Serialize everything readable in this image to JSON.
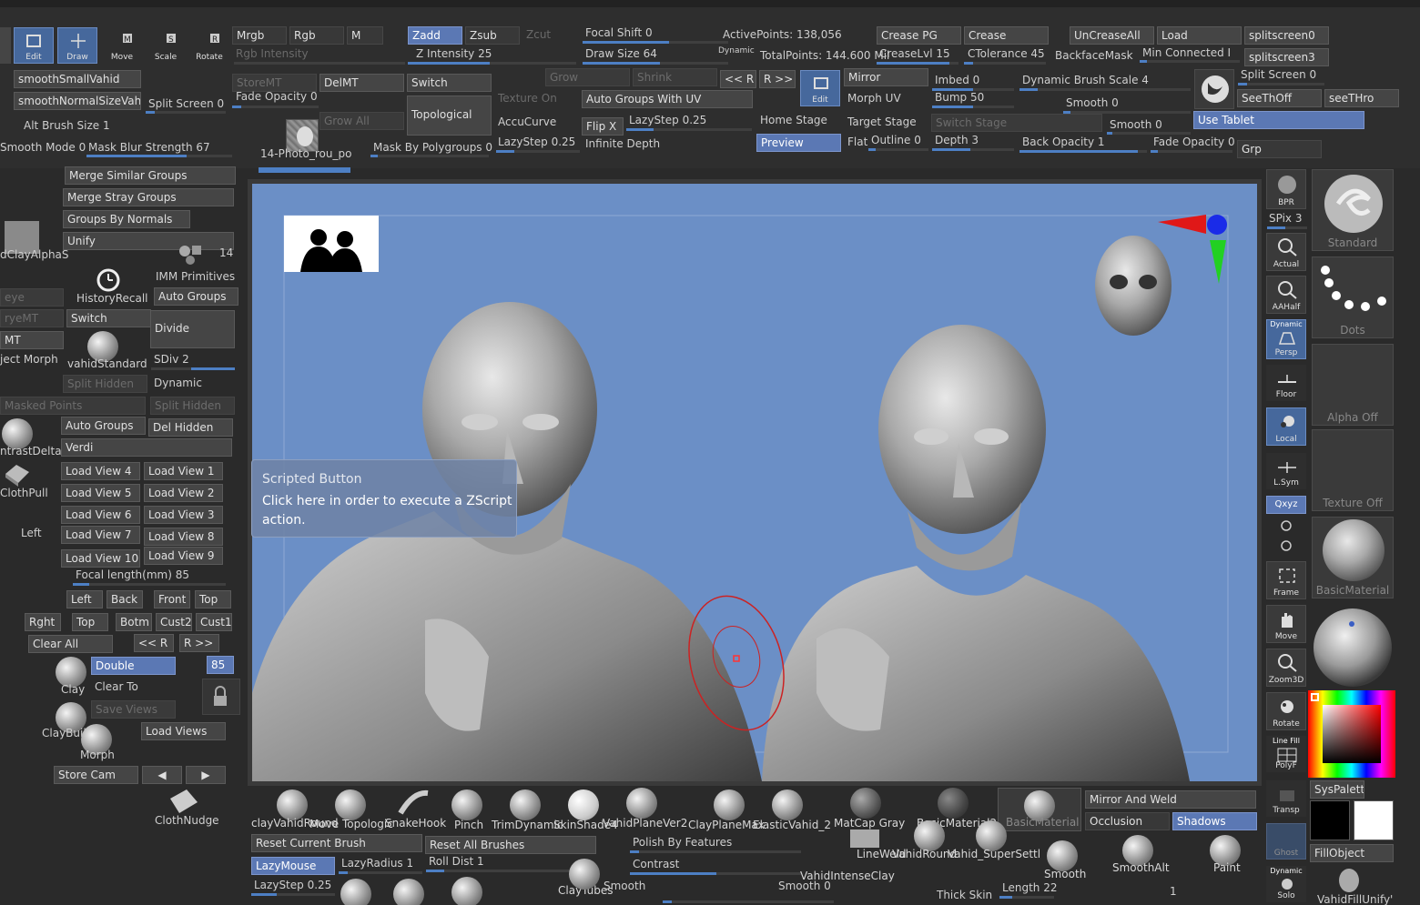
{
  "top": {
    "tool_buttons": [
      {
        "name": "edit",
        "label": "Edit"
      },
      {
        "name": "draw",
        "label": "Draw"
      },
      {
        "name": "move",
        "label": "Move"
      },
      {
        "name": "scale",
        "label": "Scale"
      },
      {
        "name": "rotate",
        "label": "Rotate"
      }
    ],
    "mrgb": "Mrgb",
    "rgb": "Rgb",
    "m": "M",
    "rgb_intensity": "Rgb Intensity",
    "zadd": "Zadd",
    "zsub": "Zsub",
    "zcut": "Zcut",
    "z_intensity": "Z Intensity 25",
    "focal_shift": "Focal Shift 0",
    "draw_size": "Draw Size 64",
    "dynamic": "Dynamic",
    "active_points": "ActivePoints: 138,056",
    "total_points": "TotalPoints: 144.600 Mil",
    "crease_pg": "Crease PG",
    "crease": "Crease",
    "crease_lvl": "CreaseLvl 15",
    "c_tolerance": "CTolerance 45",
    "uncrease_all": "UnCreaseAll",
    "load": "Load",
    "backface_mask": "BackfaceMask",
    "min_connected": "Min Connected I",
    "splitscreen0": "splitscreen0",
    "splitscreen3": "splitscreen3",
    "store_mt": "StoreMT",
    "del_mt": "DelMT",
    "switch": "Switch",
    "texture_on": "Texture On",
    "fade_opacity": "Fade Opacity 0",
    "topological": "Topological",
    "grow_all": "Grow All",
    "grow": "Grow",
    "shrink": "Shrink",
    "auto_groups_uv": "Auto Groups With UV",
    "accucurve": "AccuCurve",
    "flip_x": "Flip X",
    "lazystep_top": "LazyStep 0.25",
    "lazystep_top2": "LazyStep 0.25",
    "infinite_depth": "Infinite Depth",
    "mask_by_polygroups": "Mask By Polygroups 0",
    "r_prev": "<< R",
    "r_next": "R >>",
    "edit_small": "Edit",
    "home_stage": "Home Stage",
    "preview": "Preview",
    "mirror": "Mirror",
    "morph_uv": "Morph UV",
    "target_stage": "Target Stage",
    "switch_stage": "Switch Stage",
    "flat": "Flat",
    "outline": "Outline 0",
    "imbed": "Imbed 0",
    "bump": "Bump 50",
    "depth": "Depth 3",
    "dyn_brush_scale": "Dynamic Brush Scale 4",
    "smooth0a": "Smooth 0",
    "smooth0b": "Smooth 0",
    "back_opacity": "Back Opacity 1",
    "fade_opacity2": "Fade Opacity 0",
    "grp": "Grp",
    "split_screen_top": "Split Screen 0",
    "seethoff": "SeeThOff",
    "seethro": "seeTHro",
    "use_tablet": "Use Tablet",
    "smooth_small": "smoothSmallVahid",
    "smooth_normal": "smoothNormalSizeVahid",
    "split_screen_left": "Split Screen 0",
    "alt_brush_size": "Alt Brush Size 1",
    "smooth_mode": "Smooth Mode 0",
    "mask_blur": "Mask Blur Strength 67",
    "photo_label": "14-Photo_rou_po"
  },
  "left": {
    "merge_similar": "Merge Similar Groups",
    "merge_stray": "Merge Stray Groups",
    "groups_by_normals": "Groups By Normals",
    "unify": "Unify",
    "unify_num": "14",
    "clay_alpha": "dClayAlphaS",
    "imm_primitives": "IMM Primitives",
    "history_recall": "HistoryRecall",
    "auto_groups": "Auto Groups",
    "switch": "Switch",
    "divide": "Divide",
    "ryeq": "eye",
    "rymt": "ryeMT",
    "mt": "MT",
    "vahid_standard": "vahidStandard",
    "sdiv": "SDiv 2",
    "project_morph": "ject Morph",
    "split_hidden": "Split Hidden",
    "dynamic": "Dynamic",
    "masked_points": "Masked Points",
    "split_hidden2": "Split Hidden",
    "auto_groups2": "Auto Groups",
    "del_hidden": "Del Hidden",
    "contrast_delta": "ntrastDelta",
    "verdi": "Verdi",
    "cloth_pull": "ClothPull",
    "left_label": "Left",
    "load_views": [
      [
        "Load View 4",
        "Load View 1"
      ],
      [
        "Load View 5",
        "Load View 2"
      ],
      [
        "Load View 6",
        "Load View 3"
      ],
      [
        "Load View 7",
        "Load View 8"
      ],
      [
        "Load View 10",
        "Load View 9"
      ]
    ],
    "focal_length": "Focal length(mm) 85",
    "views_row1": [
      "Left",
      "Back",
      "Front",
      "Top"
    ],
    "views_row2": [
      "Rght",
      "Top",
      "Botm",
      "Cust2",
      "Cust1"
    ],
    "clear_all": "Clear All",
    "r_prev": "<< R",
    "r_next": "R >>",
    "double": "Double",
    "num85": "85",
    "clay": "Clay",
    "clear_to": "Clear To",
    "save_views": "Save Views",
    "clay_build": "ClayBuil",
    "load_views_btn": "Load Views",
    "morph": "Morph",
    "store_cam": "Store Cam",
    "arrow_left": "◀",
    "arrow_right": "▶",
    "cloth_nudge": "ClothNudge"
  },
  "tooltip": {
    "title": "Scripted Button",
    "body": "Click here in order to execute a ZScript action."
  },
  "right": {
    "bpr": "BPR",
    "spix": "SPix 3",
    "actual": "Actual",
    "aahalf": "AAHalf",
    "dynamic": "Dynamic",
    "persp": "Persp",
    "floor": "Floor",
    "local": "Local",
    "lsym": "L.Sym",
    "xyz": "Qxyz",
    "frame": "Frame",
    "move": "Move",
    "zoom3d": "Zoom3D",
    "rotate": "Rotate",
    "line_fill": "Line Fill",
    "polyf": "PolyF",
    "transp": "Transp",
    "ghost": "Ghost",
    "solo_dynamic": "Dynamic",
    "solo": "Solo",
    "standard": "Standard",
    "dots": "Dots",
    "alpha_off": "Alpha Off",
    "texture_off": "Texture Off",
    "basic_material": "BasicMaterial",
    "syspalette": "SysPalette",
    "fill_object": "FillObject",
    "vahid_fill_unify": "VahidFillUnify'"
  },
  "bottom": {
    "brushes_row1": [
      "clayVahidRound",
      "Move Topologic",
      "SnakeHook",
      "Pinch",
      "TrimDynamic",
      "SkinShade4",
      "VahidPlaneVer2",
      "ClayPlaneMax",
      "ElasticVahid_2"
    ],
    "matcap_gray": "MatCap Gray",
    "basic_material2": "BasicMaterial2",
    "basic_material": "BasicMaterial",
    "mirror_and_weld": "Mirror And Weld",
    "occlusion": "Occlusion",
    "shadows": "Shadows",
    "reset_current_brush": "Reset Current Brush",
    "reset_all_brushes": "Reset All Brushes",
    "polish_by_features": "Polish By Features",
    "line_weld": "LineWeld",
    "vahid_round": "VahidRound",
    "vahid_superset": "Vahid_SuperSettl",
    "smooth_brush": "Smooth",
    "smooth_alt": "SmoothAlt",
    "paint": "Paint",
    "lazy_mouse": "LazyMouse",
    "lazy_radius": "LazyRadius 1",
    "roll_dist": "Roll Dist 1",
    "contrast": "Contrast",
    "vahid_intense_clay": "VahidIntenseClay",
    "lazystep": "LazyStep 0.25",
    "clay_tubes": "ClayTubes",
    "smooth_lbl": "Smooth",
    "smooth_0": "Smooth 0",
    "thick_skin": "Thick Skin",
    "length": "Length 22",
    "num1": "1"
  },
  "colors": {
    "accent": "#5b78b4",
    "viewport_bg": "#6b8fc6",
    "panel": "#2a2a2a"
  }
}
